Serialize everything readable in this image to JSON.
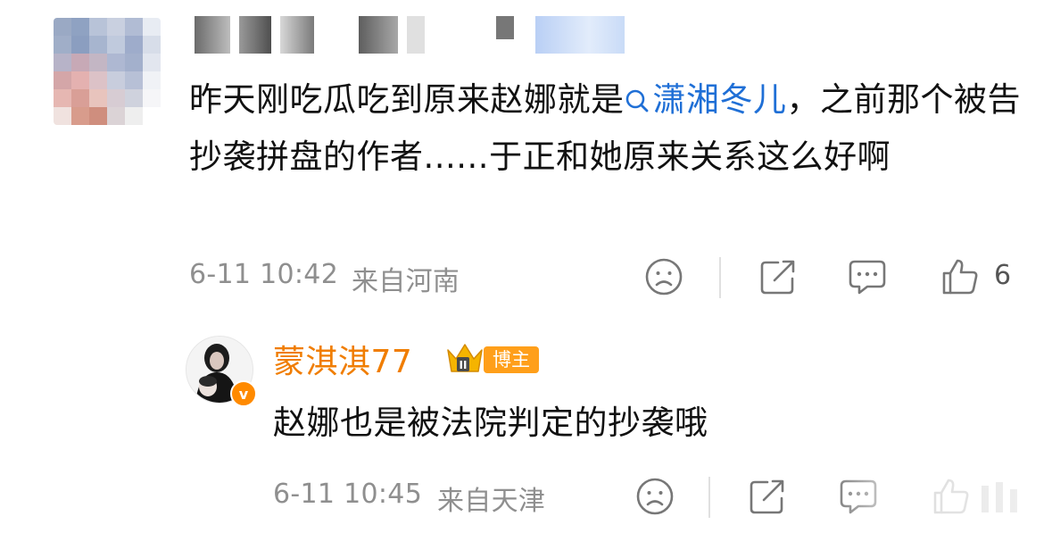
{
  "comment": {
    "text_before": "昨天刚吃瓜吃到原来赵娜就是",
    "topic": "潇湘冬儿",
    "text_after": "，之前那个被告抄袭拼盘的作者......于正和她原来关系这么好啊",
    "time": "6-11 10:42",
    "location": "来自河南",
    "like_count": "6",
    "icons": [
      "dislike-face-icon",
      "share-icon",
      "comment-icon",
      "thumbs-up-icon",
      "search-icon"
    ]
  },
  "reply": {
    "username": "蒙淇淇77",
    "verified_mark": "v",
    "badge": "博主",
    "text": "赵娜也是被法院判定的抄袭哦",
    "time": "6-11 10:45",
    "location": "来自天津",
    "icons": [
      "dislike-face-icon",
      "share-icon",
      "comment-icon",
      "thumbs-up-icon",
      "crown-icon"
    ]
  },
  "colors": {
    "topic_link": "#1f6fd6",
    "username": "#f07d00",
    "badge_bg": "#ff9f1a",
    "meta_text": "#8f8f8f"
  }
}
